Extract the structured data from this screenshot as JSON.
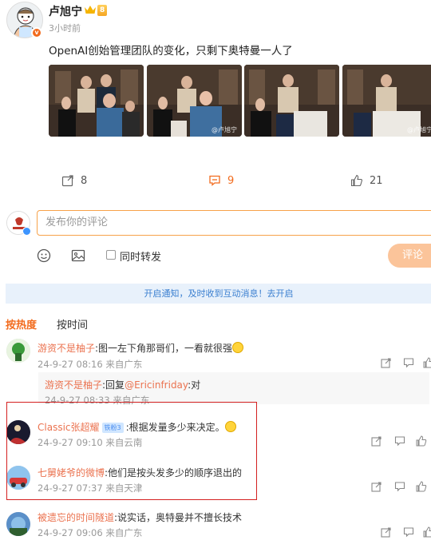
{
  "post": {
    "author": "卢旭宁",
    "vip_badge": "8",
    "time": "3小时前",
    "text": "OpenAI创始管理团队的变化，只剩下奥特曼一人了",
    "photo_watermark": "@卢旭宁",
    "actions": {
      "repost_count": "8",
      "comment_count": "9",
      "like_count": "21"
    }
  },
  "composer": {
    "placeholder": "发布你的评论",
    "repost_label": "同时转发",
    "submit_label": "评论"
  },
  "notice": "开启通知，及时收到互动消息！去开启",
  "tabs": {
    "hot": "按热度",
    "time": "按时间"
  },
  "comments": [
    {
      "name": "游资不是柚子",
      "text": ":图一左下角那哥们，一看就很强",
      "meta": "24-9-27 08:16 来自广东",
      "reply": {
        "name": "游资不是柚子",
        "prefix": ":回复",
        "mention": "@Ericinfriday",
        "text": ":对",
        "meta": "24-9-27 08:33 来自广东"
      }
    },
    {
      "name": "Classic张超耀",
      "level": "铁粉3",
      "text": ":根据发量多少来决定。",
      "meta": "24-9-27 09:10 来自云南"
    },
    {
      "name": "七舅姥爷的微博",
      "text": ":他们是按头发多少的顺序退出的",
      "meta": "24-9-27 07:37 来自天津"
    },
    {
      "name": "被遗忘的时间隧道",
      "text": ":说实话，奥特曼并不擅长技术",
      "meta": "24-9-27 09:06 来自广东"
    }
  ],
  "colors": {
    "accent": "#f26b1d",
    "link": "#eb7350",
    "notice_bg": "#e8f1fb",
    "highlight": "#d42020"
  }
}
